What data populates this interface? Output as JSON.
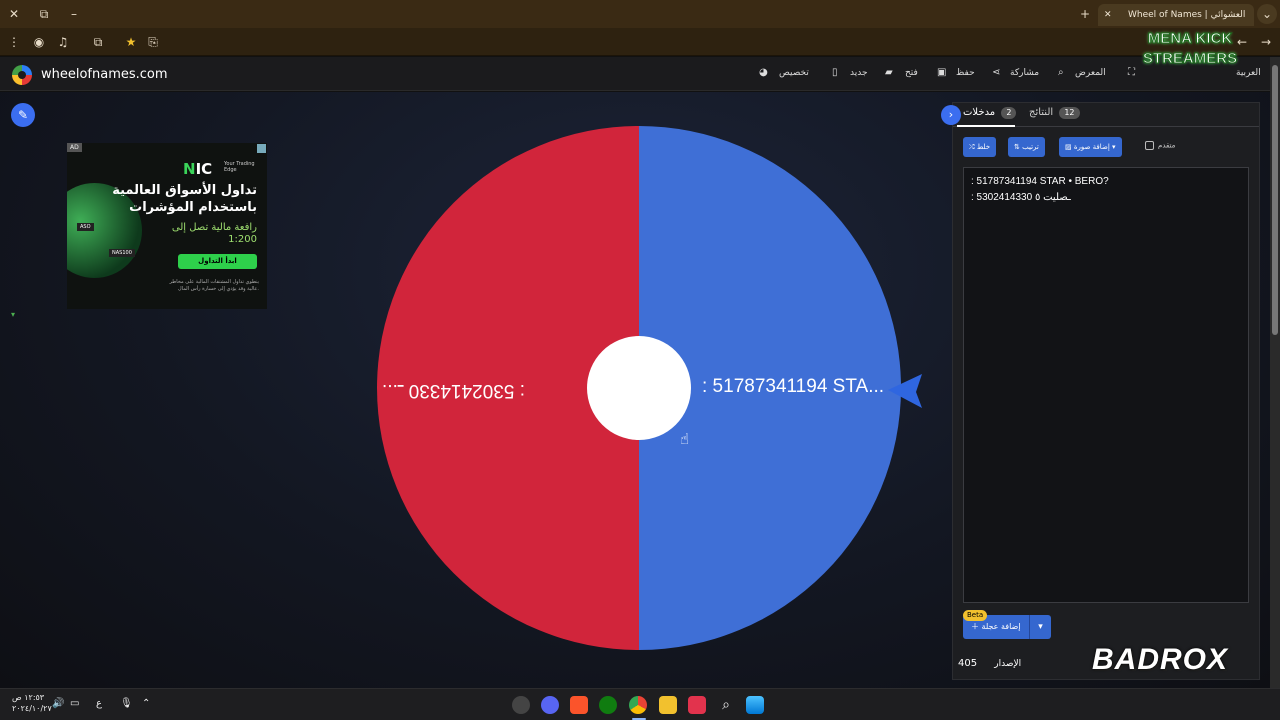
{
  "browser": {
    "tab_title": "Wheel of Names | العشوائي",
    "url": "wheelofnames",
    "tab_close": "✕",
    "new_tab": "+"
  },
  "header": {
    "logo_text": "wheelofnames.com",
    "nav": {
      "customize": "تخصيص",
      "new": "جديد",
      "open": "فتح",
      "save": "حفظ",
      "share": "مشاركة",
      "gallery": "المعرض",
      "language": "العربية"
    }
  },
  "ad": {
    "badge": "AD",
    "brand_prefix": "N",
    "brand_suffix": "IC",
    "tagline": "Your Trading Edge",
    "headline_1": "تداول الأسواق العالمية",
    "headline_2": "باستخدام المؤشرات",
    "leverage_1": "رافعة مالية تصل إلى",
    "leverage_2": "1:200",
    "cta": "ابدأ التداول",
    "fine_print": "ينطوي تداول المشتقات المالية على مخاطر عالية وقد يؤدي إلى خسارة رأس المال.",
    "pill_1": "ASO",
    "pill_2": "NAS100"
  },
  "wheel": {
    "segments": [
      {
        "label": ": 51787341194 STA...",
        "color": "#3f6fd6"
      },
      {
        "label": ": 5302414330 ـ...",
        "color": "#d1253b"
      }
    ],
    "hub_color": "#ffffff",
    "pointer_color": "#2f66e0"
  },
  "panel": {
    "tab_entries": "مدخلات",
    "entries_count": "2",
    "tab_results": "النتائج",
    "results_count": "12",
    "toolbar": {
      "shuffle": "خلط",
      "sort": "ترتيب",
      "add_image": "إضافة صورة",
      "advanced": "متقدم"
    },
    "entries": [
      ": 51787341194 STAR • BERO?",
      ": 5302414330 ـصليت ٥"
    ],
    "beta": "Beta",
    "add_wheel": "إضافة عجلة",
    "version_label": "الإصدار",
    "version_number": "405"
  },
  "overlays": {
    "mena_1": "MENA KICK",
    "mena_2": "STREAMERS",
    "badrox": "BADROX"
  },
  "taskbar": {
    "time": "١٢:٥٣ ص",
    "date": "٢٠٢٤/١٠/٢٧",
    "lang": "ع"
  },
  "colors": {
    "accent": "#3567cf",
    "wheel_blue": "#3f6fd6",
    "wheel_red": "#d1253b"
  }
}
